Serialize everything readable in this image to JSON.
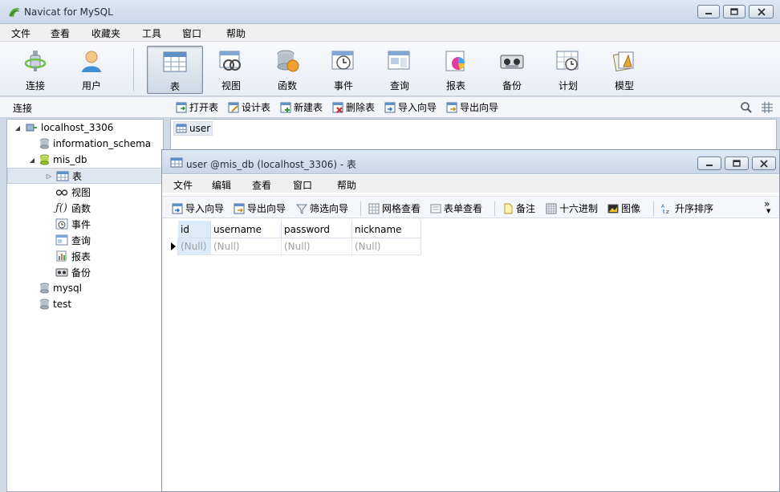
{
  "app": {
    "title": "Navicat for MySQL"
  },
  "menu": [
    "文件",
    "查看",
    "收藏夹",
    "工具",
    "窗口",
    "帮助"
  ],
  "toolbar": [
    {
      "label": "连接",
      "icon": "plug-icon"
    },
    {
      "label": "用户",
      "icon": "user-icon"
    },
    {
      "label": "表",
      "icon": "table-icon",
      "active": true
    },
    {
      "label": "视图",
      "icon": "view-icon"
    },
    {
      "label": "函数",
      "icon": "function-icon"
    },
    {
      "label": "事件",
      "icon": "event-clock-icon"
    },
    {
      "label": "查询",
      "icon": "query-icon"
    },
    {
      "label": "报表",
      "icon": "report-icon"
    },
    {
      "label": "备份",
      "icon": "backup-icon"
    },
    {
      "label": "计划",
      "icon": "schedule-icon"
    },
    {
      "label": "模型",
      "icon": "model-icon"
    }
  ],
  "subbar": {
    "connection_label": "连接",
    "buttons": [
      "打开表",
      "设计表",
      "新建表",
      "删除表",
      "导入向导",
      "导出向导"
    ]
  },
  "tree": {
    "connection": "localhost_3306",
    "databases": [
      "information_schema",
      "mis_db",
      "mysql",
      "test"
    ],
    "mis_db_children": [
      "表",
      "视图",
      "函数",
      "事件",
      "查询",
      "报表",
      "备份"
    ]
  },
  "objects": {
    "items": [
      "user"
    ]
  },
  "child": {
    "title": "user @mis_db (localhost_3306) - 表",
    "menu": [
      "文件",
      "编辑",
      "查看",
      "窗口",
      "帮助"
    ],
    "toolbar": [
      "导入向导",
      "导出向导",
      "筛选向导",
      "网格查看",
      "表单查看",
      "备注",
      "十六进制",
      "图像",
      "升序排序"
    ],
    "overflow": "»"
  },
  "table": {
    "columns": [
      "id",
      "username",
      "password",
      "nickname"
    ],
    "rows": [
      [
        "(Null)",
        "(Null)",
        "(Null)",
        "(Null)"
      ]
    ]
  },
  "colors": {
    "accent": "#4a7fc1",
    "titlebar": "#d4e0ef",
    "selected": "#dfe6ef"
  }
}
